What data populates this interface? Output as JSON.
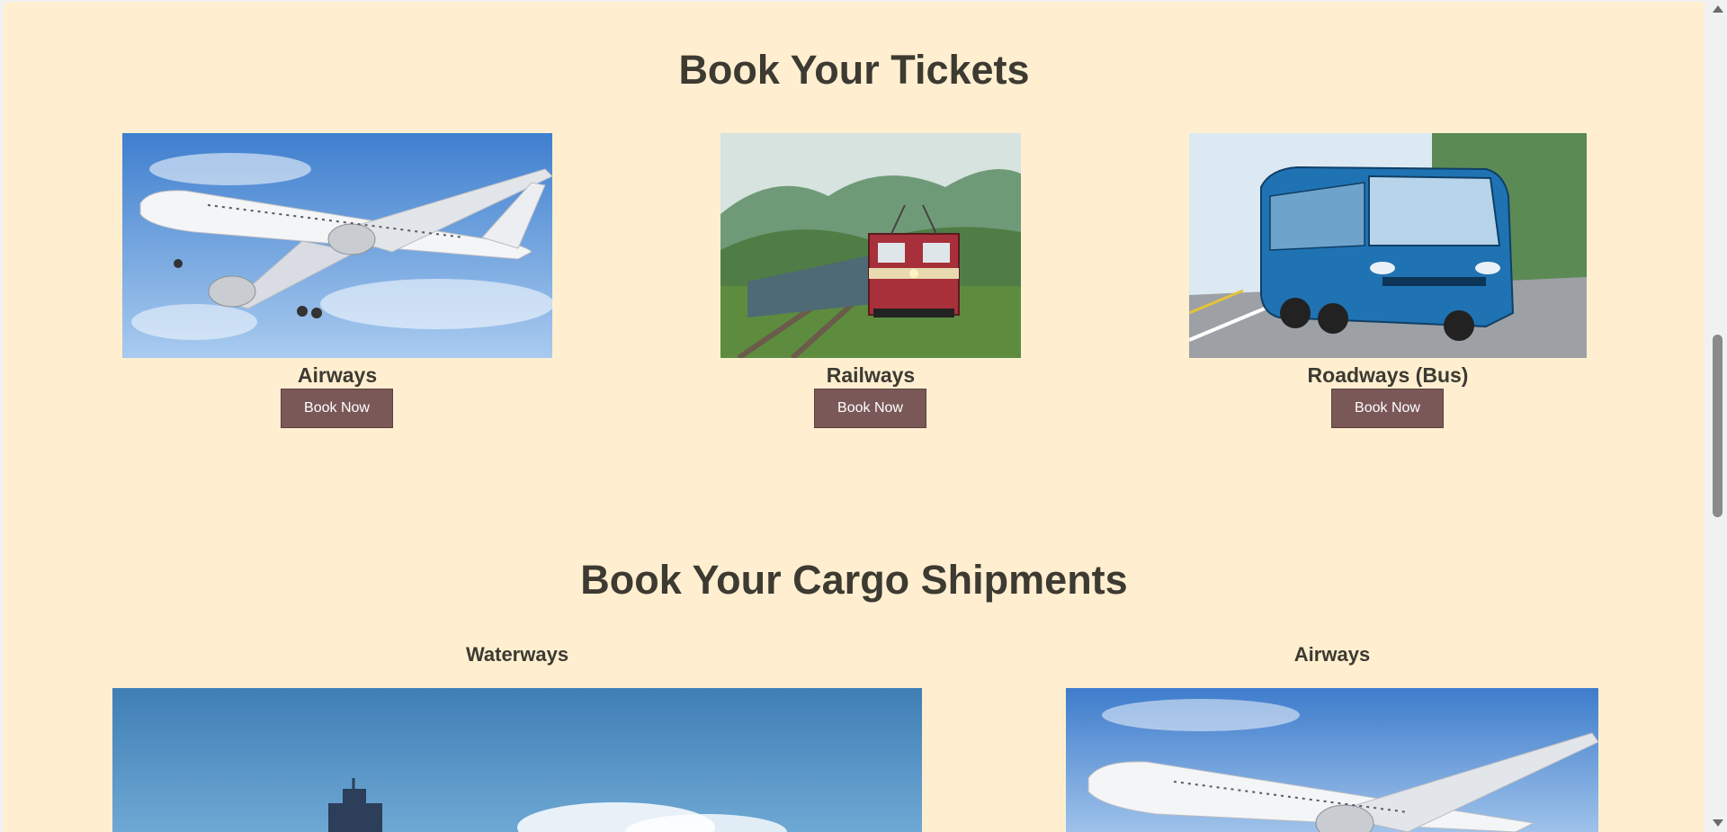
{
  "tickets": {
    "title": "Book Your Tickets",
    "cards": [
      {
        "label": "Airways",
        "button": "Book Now",
        "image": "airplane-photo"
      },
      {
        "label": "Railways",
        "button": "Book Now",
        "image": "train-photo"
      },
      {
        "label": "Roadways (Bus)",
        "button": "Book Now",
        "image": "bus-photo"
      }
    ]
  },
  "cargo": {
    "title": "Book Your Cargo Shipments",
    "cards": [
      {
        "label": "Waterways",
        "image": "ship-photo"
      },
      {
        "label": "Airways",
        "image": "airplane-photo"
      }
    ]
  },
  "colors": {
    "background": "#ffefd0",
    "heading": "#3d3a32",
    "button": "#7b5858",
    "button_text": "#ffffff"
  }
}
